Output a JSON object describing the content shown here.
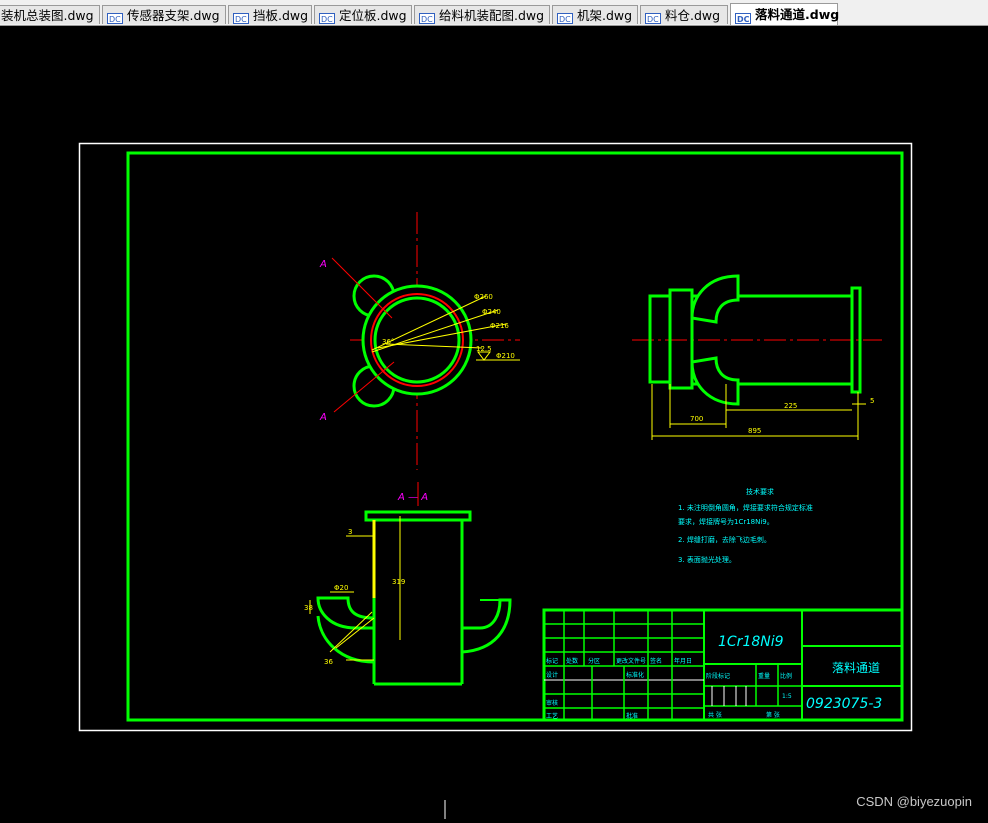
{
  "tabs": [
    {
      "label": "装机总装图.dwg",
      "active": false
    },
    {
      "label": "传感器支架.dwg",
      "active": false
    },
    {
      "label": "挡板.dwg",
      "active": false
    },
    {
      "label": "定位板.dwg",
      "active": false
    },
    {
      "label": "给料机装配图.dwg",
      "active": false
    },
    {
      "label": "机架.dwg",
      "active": false
    },
    {
      "label": "料仓.dwg",
      "active": false
    },
    {
      "label": "落料通道.dwg",
      "active": true
    }
  ],
  "drawing": {
    "material": "1Cr18Ni9",
    "part_name": "落料通道",
    "drawing_no": "0923075-3",
    "section_label": "A",
    "section_view_label": "A — A",
    "tech_req_title": "技术要求",
    "tech_req_items": [
      "1. 未注明倒角圆角，焊接要求符合规定标准",
      "   要求，焊接牌号为1Cr18Ni9。",
      "2. 焊缝打磨，去除飞边毛刺。",
      "3. 表面抛光处理。"
    ],
    "dims": {
      "phi260": "Φ260",
      "phi240": "Φ240",
      "phi216": "Φ216",
      "angle": "36°",
      "r125": "12.5",
      "phi210": "Φ210",
      "d700": "700",
      "d225": "225",
      "d5": "5",
      "d895": "895",
      "d3": "3",
      "d319": "319",
      "d36": "36",
      "d38": "38",
      "d20": "Φ20"
    },
    "title_block_labels": [
      "标记",
      "处数",
      "分区",
      "更改文件号",
      "签名",
      "年月日",
      "设计",
      "标准化",
      "审核",
      "工艺",
      "批准",
      "阶段标记",
      "重量",
      "比例",
      "共  张",
      "第  张"
    ],
    "scale": "1:5"
  },
  "watermark": "CSDN @biyezuopin",
  "colors": {
    "green": "#00ff00",
    "yellow": "#ffff00",
    "red": "#ff0000",
    "magenta": "#ff00ff",
    "cyan": "#00ffff",
    "white": "#ffffff"
  }
}
